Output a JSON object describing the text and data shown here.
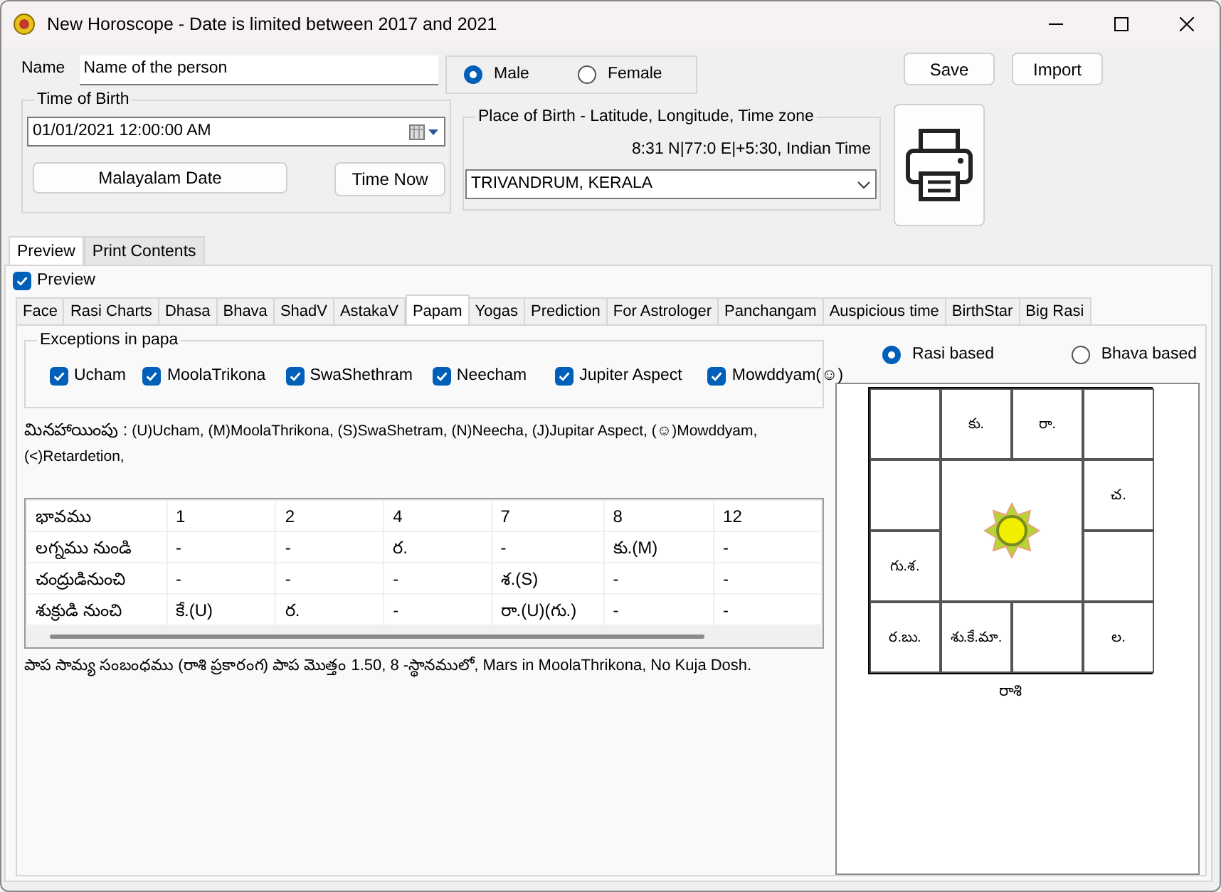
{
  "window": {
    "title": "New Horoscope - Date is limited between 2017 and 2021"
  },
  "name_field": {
    "label": "Name",
    "value": "Name of the person"
  },
  "gender": [
    {
      "label": "Male",
      "selected": true
    },
    {
      "label": "Female",
      "selected": false
    }
  ],
  "buttons": [
    "Save",
    "Import"
  ],
  "time_of_birth": {
    "title": "Time of Birth",
    "value": "01/01/2021  12:00:00 AM",
    "buttons": [
      "Malayalam Date",
      "Time Now"
    ]
  },
  "place_of_birth": {
    "title": "Place of Birth - Latitude, Longitude, Time zone",
    "coordinates": "8:31 N|77:0 E|+5:30, Indian Time",
    "value": "TRIVANDRUM, KERALA"
  },
  "outer_tabs": [
    {
      "label": "Preview",
      "selected": true
    },
    {
      "label": "Print Contents",
      "selected": false
    }
  ],
  "preview_checkbox": {
    "label": "Preview",
    "checked": true
  },
  "tabs": [
    {
      "label": "Face",
      "selected": false
    },
    {
      "label": "Rasi Charts",
      "selected": false
    },
    {
      "label": "Dhasa",
      "selected": false
    },
    {
      "label": "Bhava",
      "selected": false
    },
    {
      "label": "ShadV",
      "selected": false
    },
    {
      "label": "AstakaV",
      "selected": false
    },
    {
      "label": "Papam",
      "selected": true
    },
    {
      "label": "Yogas",
      "selected": false
    },
    {
      "label": "Prediction",
      "selected": false
    },
    {
      "label": "For Astrologer",
      "selected": false
    },
    {
      "label": "Panchangam",
      "selected": false
    },
    {
      "label": "Auspicious time",
      "selected": false
    },
    {
      "label": "BirthStar",
      "selected": false
    },
    {
      "label": "Big Rasi",
      "selected": false
    }
  ],
  "exceptions": {
    "title": "Exceptions in papa",
    "items": [
      {
        "label": "Ucham",
        "checked": true
      },
      {
        "label": "MoolaTrikona",
        "checked": true
      },
      {
        "label": "SwaShethram",
        "checked": true
      },
      {
        "label": "Neecham",
        "checked": true
      },
      {
        "label": "Jupiter Aspect",
        "checked": true
      },
      {
        "label": "Mowddyam(☺)",
        "checked": true
      }
    ]
  },
  "legend": {
    "label": "మినహాయింపు :",
    "text": "(U)Ucham, (M)MoolaThrikona, (S)SwaShetram, (N)Neecha, (J)Jupitar Aspect, (☺)Mowddyam, (<)Retardetion,"
  },
  "table": {
    "columns": [
      "భావము",
      "1",
      "2",
      "4",
      "7",
      "8",
      "12"
    ],
    "rows": [
      [
        "లగ్నము నుండి",
        "-",
        "-",
        "ర.",
        "-",
        "కు.(M)",
        "-"
      ],
      [
        "చంద్రుడినుంచి",
        "-",
        "-",
        "-",
        "శ.(S)",
        "-",
        "-"
      ],
      [
        "శుక్రుడి నుంచి",
        "కే.(U)",
        "ర.",
        "-",
        "రా.(U)(గు.)",
        "-",
        "-"
      ]
    ]
  },
  "summary": "పాప సామ్య సంబంధము (రాశి ప్రకారంగ) పాప మొత్తం  1.50,  8 -స్థానములో,  Mars in  MoolaThrikona, No Kuja Dosh.",
  "chart_mode": [
    {
      "label": "Rasi based",
      "selected": true
    },
    {
      "label": "Bhava based",
      "selected": false
    }
  ],
  "rasi_chart": {
    "cells": [
      "",
      "కు.",
      "రా.",
      "",
      "",
      "చ.",
      "గు.శ.",
      "",
      "ర.బు.",
      "శు.కే.మా.",
      "",
      "ల."
    ],
    "caption": "రాశి"
  }
}
